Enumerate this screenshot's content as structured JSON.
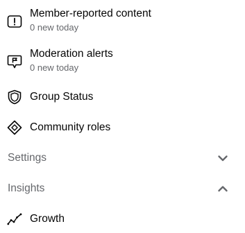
{
  "menu": {
    "items": [
      {
        "title": "Member-reported content",
        "subtitle": "0 new today",
        "icon": "alert-box-icon"
      },
      {
        "title": "Moderation alerts",
        "subtitle": "0 new today",
        "icon": "speech-bubble-flag-icon"
      },
      {
        "title": "Group Status",
        "icon": "shield-icon"
      },
      {
        "title": "Community roles",
        "icon": "diamond-icon"
      }
    ],
    "sections": [
      {
        "label": "Settings",
        "state": "collapsed",
        "icon": "chevron-down-icon"
      },
      {
        "label": "Insights",
        "state": "expanded",
        "icon": "chevron-up-icon"
      }
    ],
    "insights_items": [
      {
        "title": "Growth",
        "icon": "growth-line-icon"
      }
    ]
  },
  "colors": {
    "text_primary": "#050505",
    "text_secondary": "#65676b",
    "background": "#ffffff"
  }
}
